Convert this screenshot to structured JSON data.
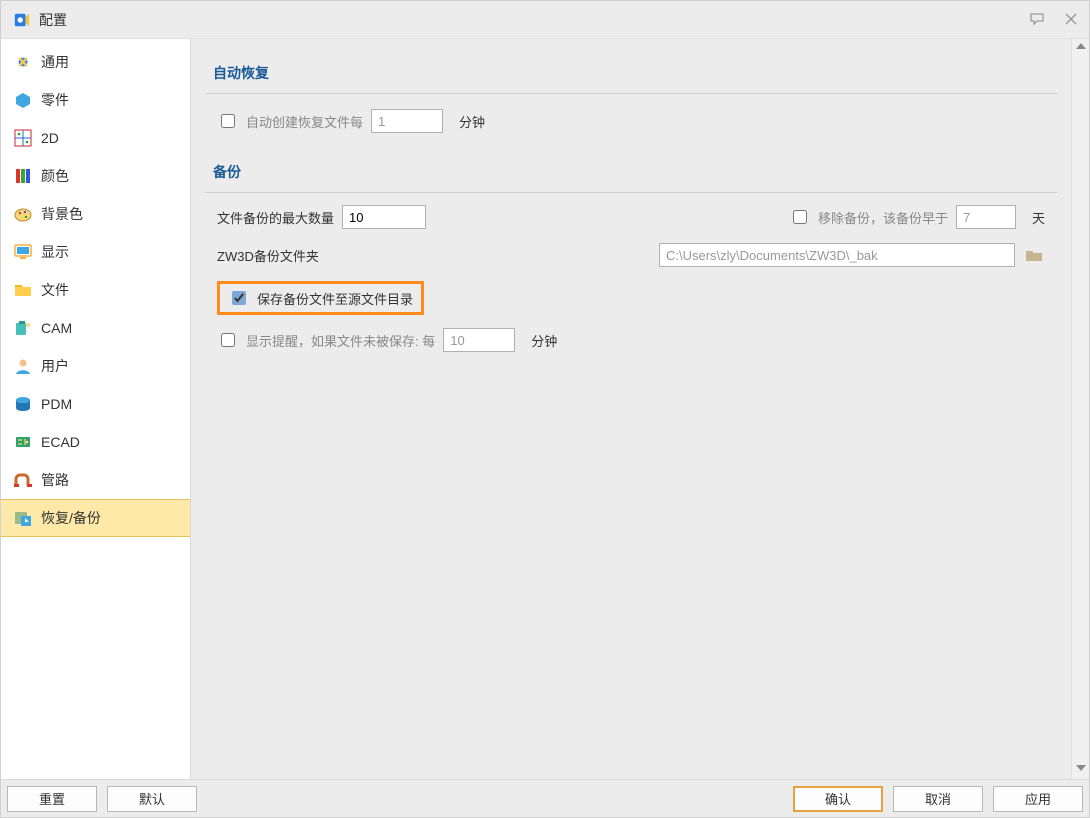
{
  "window": {
    "title": "配置"
  },
  "sidebar": {
    "items": [
      {
        "label": "通用",
        "icon": "gear"
      },
      {
        "label": "零件",
        "icon": "part"
      },
      {
        "label": "2D",
        "icon": "grid"
      },
      {
        "label": "颜色",
        "icon": "palette"
      },
      {
        "label": "背景色",
        "icon": "bg"
      },
      {
        "label": "显示",
        "icon": "monitor"
      },
      {
        "label": "文件",
        "icon": "folder"
      },
      {
        "label": "CAM",
        "icon": "cam"
      },
      {
        "label": "用户",
        "icon": "user"
      },
      {
        "label": "PDM",
        "icon": "pdm"
      },
      {
        "label": "ECAD",
        "icon": "ecad"
      },
      {
        "label": "管路",
        "icon": "pipe"
      },
      {
        "label": "恢复/备份",
        "icon": "recover"
      }
    ],
    "selected_index": 12
  },
  "sections": {
    "auto_recover": {
      "title": "自动恢复",
      "create_label": "自动创建恢复文件每",
      "create_checked": false,
      "interval_value": "1",
      "interval_unit": "分钟"
    },
    "backup": {
      "title": "备份",
      "max_label": "文件备份的最大数量",
      "max_value": "10",
      "remove_label": "移除备份，该备份早于",
      "remove_checked": false,
      "remove_value": "7",
      "remove_unit": "天",
      "folder_label": "ZW3D备份文件夹",
      "folder_path": "C:\\Users\\zly\\Documents\\ZW3D\\_bak",
      "save_to_src_label": "保存备份文件至源文件目录",
      "save_to_src_checked": true,
      "remind_label": "显示提醒，如果文件未被保存: 每",
      "remind_checked": false,
      "remind_value": "10",
      "remind_unit": "分钟"
    }
  },
  "footer": {
    "reset": "重置",
    "default": "默认",
    "ok": "确认",
    "cancel": "取消",
    "apply": "应用"
  }
}
